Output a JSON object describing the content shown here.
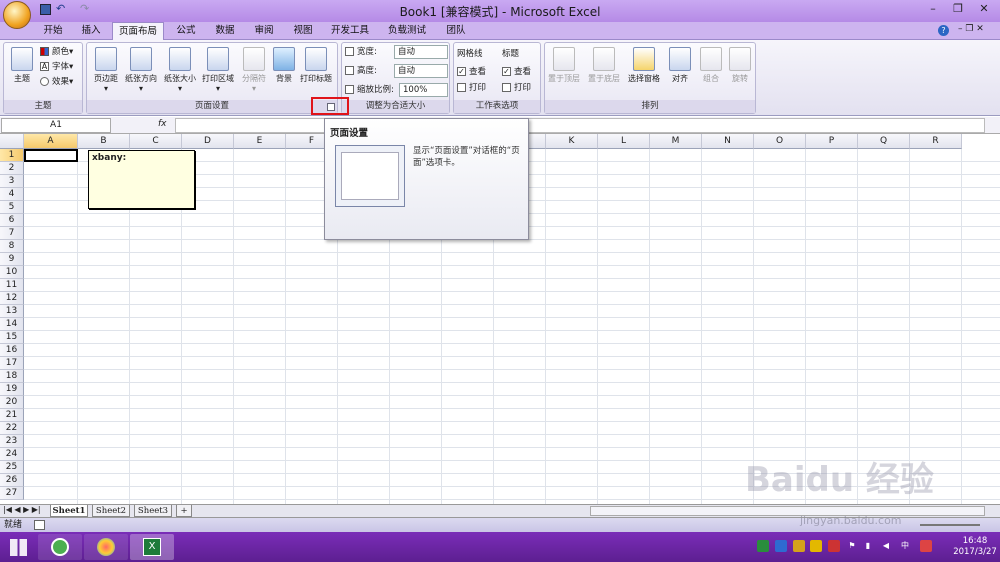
{
  "window": {
    "title": "Book1 [兼容模式] - Microsoft Excel"
  },
  "tabs": [
    "开始",
    "插入",
    "页面布局",
    "公式",
    "数据",
    "审阅",
    "视图",
    "开发工具",
    "负载测试",
    "团队"
  ],
  "ribbon": {
    "theme": {
      "label": "主题",
      "big": "主题",
      "colors": "颜色",
      "fonts": "字体",
      "effects": "效果"
    },
    "page_setup": {
      "label": "页面设置",
      "margins": "页边距",
      "orientation": "纸张方向",
      "size": "纸张大小",
      "print_area": "打印区域",
      "breaks": "分隔符",
      "background": "背景",
      "print_titles": "打印标题"
    },
    "scale": {
      "label": "调整为合适大小",
      "width_label": "宽度:",
      "width_value": "自动",
      "height_label": "高度:",
      "height_value": "自动",
      "scale_label": "缩放比例:",
      "scale_value": "100%"
    },
    "sheet_options": {
      "label": "工作表选项",
      "gridlines": "网格线",
      "headings": "标题",
      "view": "查看",
      "print": "打印"
    },
    "arrange": {
      "label": "排列",
      "bring_forward": "置于顶层",
      "send_backward": "置于底层",
      "selection_pane": "选择窗格",
      "align": "对齐",
      "group": "组合",
      "rotate": "旋转"
    }
  },
  "formula": {
    "namebox": "A1",
    "fx": "fx"
  },
  "columns": [
    "A",
    "B",
    "C",
    "D",
    "E",
    "F",
    "G",
    "H",
    "I",
    "J",
    "K",
    "L",
    "M",
    "N",
    "O",
    "P",
    "Q",
    "R"
  ],
  "rows": [
    "1",
    "2",
    "3",
    "4",
    "5",
    "6",
    "7",
    "8",
    "9",
    "10",
    "11",
    "12",
    "13",
    "14",
    "15",
    "16",
    "17",
    "18",
    "19",
    "20",
    "21",
    "22",
    "23",
    "24",
    "25",
    "26",
    "27"
  ],
  "comment": {
    "text": "xbany:"
  },
  "tooltip": {
    "title": "页面设置",
    "desc": "显示“页面设置”对话框的“页面”选项卡。"
  },
  "sheets": [
    "Sheet1",
    "Sheet2",
    "Sheet3"
  ],
  "status": {
    "ready": "就绪"
  },
  "taskbar": {
    "time": "16:48",
    "date": "2017/3/27",
    "ime": "中"
  },
  "watermark": {
    "text": "Baidu 经验",
    "url": "jingyan.baidu.com"
  }
}
